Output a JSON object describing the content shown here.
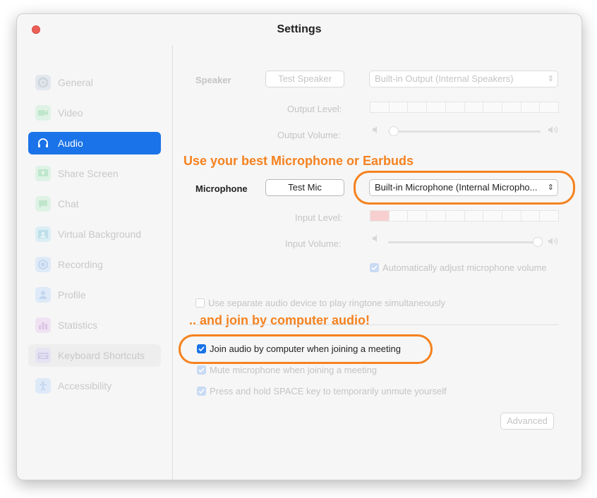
{
  "window": {
    "title": "Settings"
  },
  "sidebar": {
    "items": [
      {
        "label": "General",
        "icon": "gear-icon"
      },
      {
        "label": "Video",
        "icon": "video-camera-icon"
      },
      {
        "label": "Audio",
        "icon": "headphones-icon",
        "active": true
      },
      {
        "label": "Share Screen",
        "icon": "share-screen-icon"
      },
      {
        "label": "Chat",
        "icon": "chat-bubble-icon"
      },
      {
        "label": "Virtual Background",
        "icon": "person-background-icon"
      },
      {
        "label": "Recording",
        "icon": "record-icon"
      },
      {
        "label": "Profile",
        "icon": "profile-icon"
      },
      {
        "label": "Statistics",
        "icon": "bar-chart-icon"
      },
      {
        "label": "Keyboard Shortcuts",
        "icon": "keyboard-icon"
      },
      {
        "label": "Accessibility",
        "icon": "accessibility-icon"
      }
    ]
  },
  "speaker": {
    "label": "Speaker",
    "test_button": "Test Speaker",
    "device": "Built-in Output (Internal Speakers)",
    "output_level_label": "Output Level:",
    "output_volume_label": "Output Volume:",
    "output_volume_value": 0.02
  },
  "microphone": {
    "label": "Microphone",
    "test_button": "Test Mic",
    "device": "Built-in Microphone (Internal Micropho...",
    "input_level_label": "Input Level:",
    "input_level_value": 0.1,
    "input_volume_label": "Input Volume:",
    "input_volume_value": 0.98,
    "auto_adjust_label": "Automatically adjust microphone volume",
    "auto_adjust_checked": true
  },
  "options": {
    "separate_device_label": "Use separate audio device to play ringtone simultaneously",
    "separate_device_checked": false,
    "join_audio_label": "Join audio by computer when joining a meeting",
    "join_audio_checked": true,
    "mute_label": "Mute microphone when joining a meeting",
    "mute_checked": true,
    "space_label": "Press and hold SPACE key to temporarily unmute yourself",
    "space_checked": true,
    "advanced_button": "Advanced"
  },
  "annotations": {
    "top": "Use your best Microphone or Earbuds",
    "bottom": ".. and join by computer audio!"
  },
  "colors": {
    "accent": "#1a73e8",
    "annotation": "#f5821f",
    "close": "#ec5f57"
  }
}
